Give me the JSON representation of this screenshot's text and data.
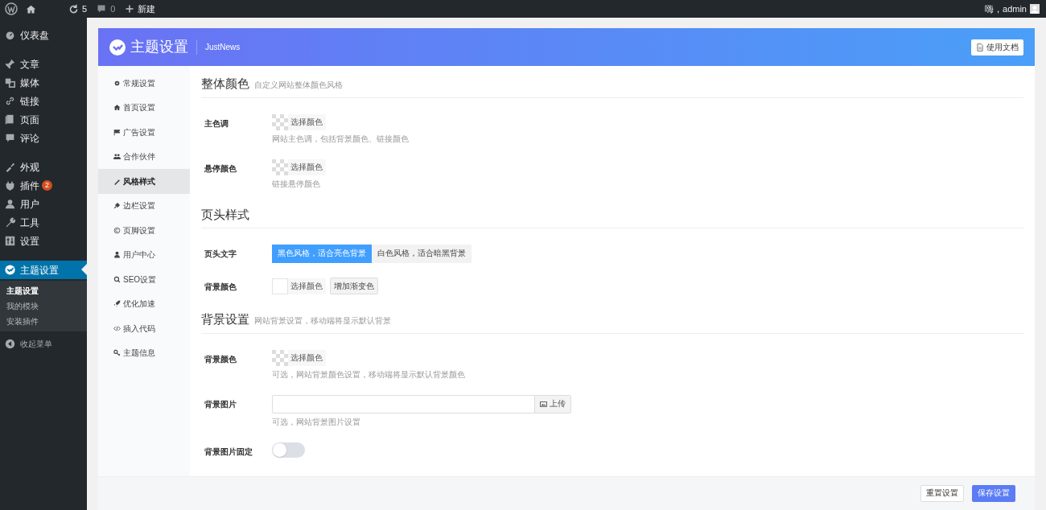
{
  "admin_bar": {
    "updates": "5",
    "comments": "0",
    "new_label": "新建",
    "greeting": "嗨，admin"
  },
  "sidebar": {
    "groups": [
      [
        {
          "label": "仪表盘",
          "selected": false
        }
      ],
      [
        {
          "label": "文章",
          "selected": false
        },
        {
          "label": "媒体",
          "selected": false
        },
        {
          "label": "链接",
          "selected": false
        },
        {
          "label": "页面",
          "selected": false
        },
        {
          "label": "评论",
          "selected": false
        }
      ],
      [
        {
          "label": "外观",
          "selected": false
        },
        {
          "label": "插件",
          "selected": false,
          "badge": "2"
        },
        {
          "label": "用户",
          "selected": false
        },
        {
          "label": "工具",
          "selected": false
        },
        {
          "label": "设置",
          "selected": false
        }
      ],
      [
        {
          "label": "主题设置",
          "selected": true,
          "children": [
            {
              "label": "主题设置",
              "selected": true
            },
            {
              "label": "我的模块",
              "selected": false
            },
            {
              "label": "安装插件",
              "selected": false
            }
          ]
        }
      ]
    ],
    "collapse": "收起菜单"
  },
  "panel": {
    "title": "主题设置",
    "subtitle": "JustNews",
    "docs_button": "使用文档",
    "tabs": [
      {
        "label": "常规设置",
        "selected": false
      },
      {
        "label": "首页设置",
        "selected": false
      },
      {
        "label": "广告设置",
        "selected": false
      },
      {
        "label": "合作伙伴",
        "selected": false
      },
      {
        "label": "风格样式",
        "selected": true
      },
      {
        "label": "边栏设置",
        "selected": false
      },
      {
        "label": "页脚设置",
        "selected": false
      },
      {
        "label": "用户中心",
        "selected": false
      },
      {
        "label": "SEO设置",
        "selected": false
      },
      {
        "label": "优化加速",
        "selected": false
      },
      {
        "label": "插入代码",
        "selected": false
      },
      {
        "label": "主题信息",
        "selected": false
      }
    ],
    "sections": [
      {
        "title": "整体颜色",
        "description": "自定义网站整体颜色风格",
        "fields": [
          {
            "kind": "color",
            "label": "主色调",
            "button": "选择颜色",
            "empty": true,
            "help": "网站主色调，包括背景颜色、链接颜色"
          },
          {
            "kind": "color",
            "label": "悬停颜色",
            "button": "选择颜色",
            "empty": true,
            "help": "链接悬停颜色"
          }
        ]
      },
      {
        "title": "页头样式",
        "fields": [
          {
            "kind": "choice",
            "label": "页头文字",
            "options": [
              {
                "label": "黑色风格，适合亮色背景",
                "selected": true
              },
              {
                "label": "白色风格，适合暗黑背景",
                "selected": false
              }
            ]
          },
          {
            "kind": "color",
            "label": "背景颜色",
            "button": "选择颜色",
            "empty": false,
            "extra_button": "增加渐变色"
          }
        ]
      },
      {
        "title": "背景设置",
        "description": "网站背景设置，移动端将显示默认背景",
        "fields": [
          {
            "kind": "color",
            "label": "背景颜色",
            "button": "选择颜色",
            "empty": true,
            "help": "可选，网站背景颜色设置，移动端将显示默认背景颜色"
          },
          {
            "kind": "upload",
            "label": "背景图片",
            "button": "上传",
            "help": "可选，网站背景图片设置"
          },
          {
            "kind": "toggle",
            "label": "背景图片固定",
            "on": false
          }
        ]
      }
    ],
    "reset_button": "重置设置",
    "save_button": "保存设置"
  }
}
